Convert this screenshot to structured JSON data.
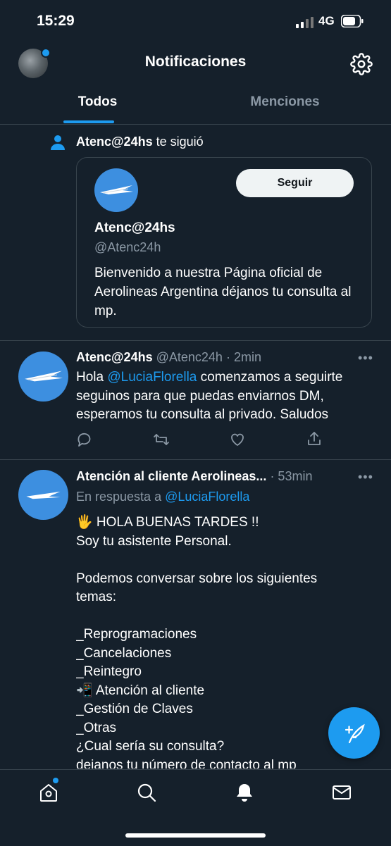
{
  "status_bar": {
    "time": "15:29",
    "network": "4G"
  },
  "header": {
    "title": "Notificaciones"
  },
  "tabs": [
    {
      "label": "Todos",
      "active": true
    },
    {
      "label": "Menciones",
      "active": false
    }
  ],
  "follow_notification": {
    "user": "Atenc@24hs",
    "action": "te siguió",
    "card": {
      "follow_button": "Seguir",
      "name": "Atenc@24hs",
      "handle": "@Atenc24h",
      "bio": "Bienvenido a nuestra Página oficial de Aerolineas Argentina déjanos tu consulta al mp."
    }
  },
  "tweet1": {
    "name": "Atenc@24hs",
    "handle": "@Atenc24h",
    "time": "· 2min",
    "more": "•••",
    "body_before": "Hola ",
    "mention": "@LuciaFlorella",
    "body_after": " comenzamos a seguirte seguinos para que puedas enviarnos DM, esperamos tu consulta al privado. Saludos"
  },
  "tweet2": {
    "name": "Atención al cliente Aerolineas...",
    "time": "· 53min",
    "more": "•••",
    "reply_prefix": "En respuesta a ",
    "reply_to": "@LuciaFlorella",
    "lines": [
      "🖐 HOLA BUENAS TARDES !!",
      "Soy tu asistente Personal.",
      "",
      "Podemos conversar sobre los siguientes",
      "temas:",
      "",
      "_Reprogramaciones",
      "_Cancelaciones",
      "_Reintegro",
      "📲 Atención al cliente",
      "_Gestión de Claves",
      "_Otras",
      "¿Cual sería su consulta?",
      "dejanos tu número de contacto al mp"
    ]
  },
  "icons": {
    "gear": "gear-icon",
    "person": "person-icon",
    "reply": "reply-icon",
    "retweet": "retweet-icon",
    "like": "heart-icon",
    "share": "share-icon",
    "compose": "compose-icon",
    "home": "home-icon",
    "search": "search-icon",
    "notifications": "bell-icon",
    "messages": "mail-icon"
  },
  "colors": {
    "background": "#15202b",
    "accent": "#1d9bf0",
    "muted": "#8b98a5",
    "divider": "#38444d"
  }
}
